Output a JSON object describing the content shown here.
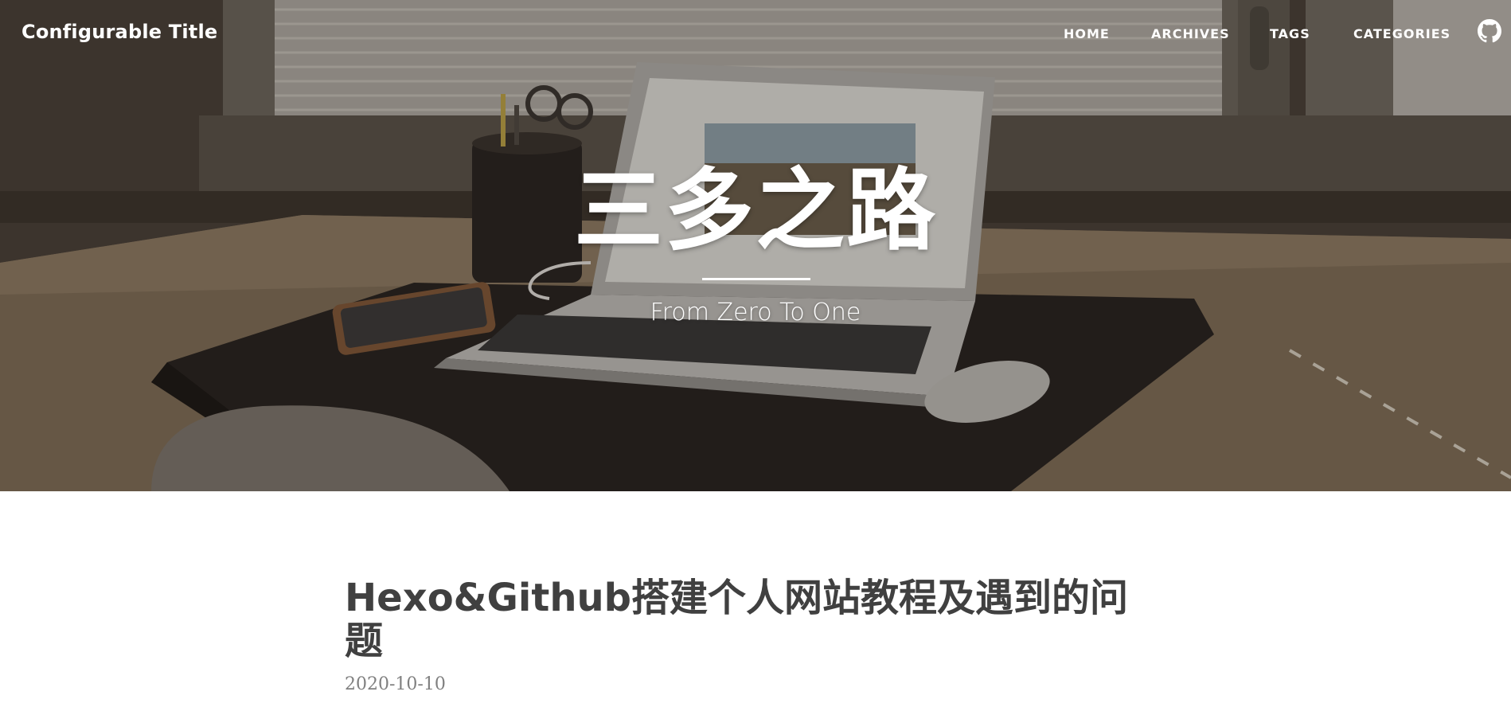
{
  "site": {
    "title": "Configurable Title"
  },
  "nav": {
    "items": [
      {
        "label": "HOME"
      },
      {
        "label": "ARCHIVES"
      },
      {
        "label": "TAGS"
      },
      {
        "label": "CATEGORIES"
      }
    ],
    "github_icon": "github-icon"
  },
  "hero": {
    "heading": "三多之路",
    "subheading": "From Zero To One",
    "image": "desk-laptop-photo"
  },
  "posts": [
    {
      "title": "Hexo&Github搭建个人网站教程及遇到的问题",
      "date": "2020-10-10"
    }
  ],
  "colors": {
    "hero_text": "#ffffff",
    "post_title": "#404040",
    "post_meta": "#808080"
  }
}
